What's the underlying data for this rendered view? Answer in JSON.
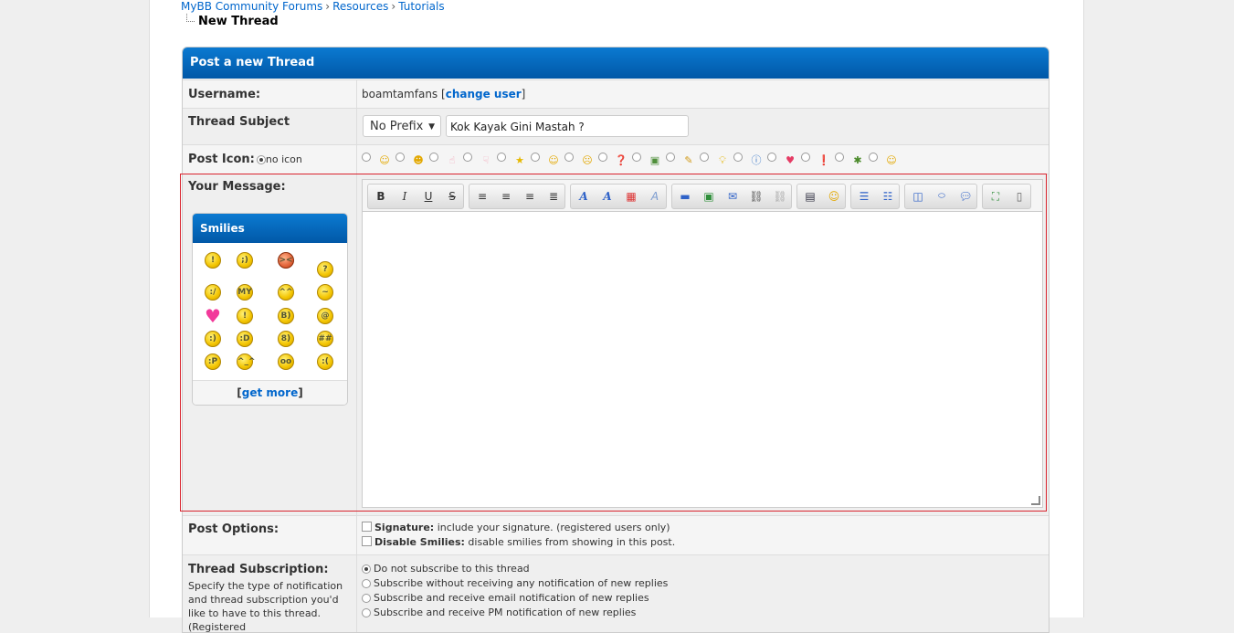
{
  "breadcrumb": {
    "items": [
      "MyBB Community Forums",
      "Resources",
      "Tutorials"
    ],
    "separator": "›",
    "current": "New Thread"
  },
  "form": {
    "title": "Post a new Thread",
    "username": {
      "label": "Username:",
      "value": "boamtamfans",
      "bracket_open": "[",
      "change_link": "change user",
      "bracket_close": "]"
    },
    "subject": {
      "label": "Thread Subject",
      "prefix_selected": "No Prefix",
      "value": "Kok Kayak Gini Mastah ?"
    },
    "post_icon": {
      "label": "Post Icon:",
      "no_icon_label": "no icon",
      "icons": [
        "smiley-icon",
        "wink-icon",
        "tongue-icon",
        "thumbs-up-icon",
        "thumbs-down-icon",
        "star-icon",
        "happy-icon",
        "sad-icon",
        "question-icon",
        "photo-icon",
        "pencil-icon",
        "lightbulb-icon",
        "info-icon",
        "heart-icon",
        "exclamation-icon",
        "bug-icon",
        "angel-icon"
      ]
    },
    "message": {
      "label": "Your Message:",
      "smilies": {
        "title": "Smilies",
        "get_more_open": "[",
        "get_more_link": "get more",
        "get_more_close": "]"
      }
    },
    "post_options": {
      "label": "Post Options:",
      "signature_bold": "Signature:",
      "signature_text": "include your signature. (registered users only)",
      "disable_smilies_bold": "Disable Smilies:",
      "disable_smilies_text": "disable smilies from showing in this post."
    },
    "subscription": {
      "label": "Thread Subscription:",
      "description": "Specify the type of notification and thread subscription you'd like to have to this thread. (Registered",
      "options": [
        "Do not subscribe to this thread",
        "Subscribe without receiving any notification of new replies",
        "Subscribe and receive email notification of new replies",
        "Subscribe and receive PM notification of new replies"
      ]
    }
  },
  "colors": {
    "header_blue": "#0158a7",
    "link_blue": "#0066cc",
    "highlight_red": "#d9232d"
  }
}
